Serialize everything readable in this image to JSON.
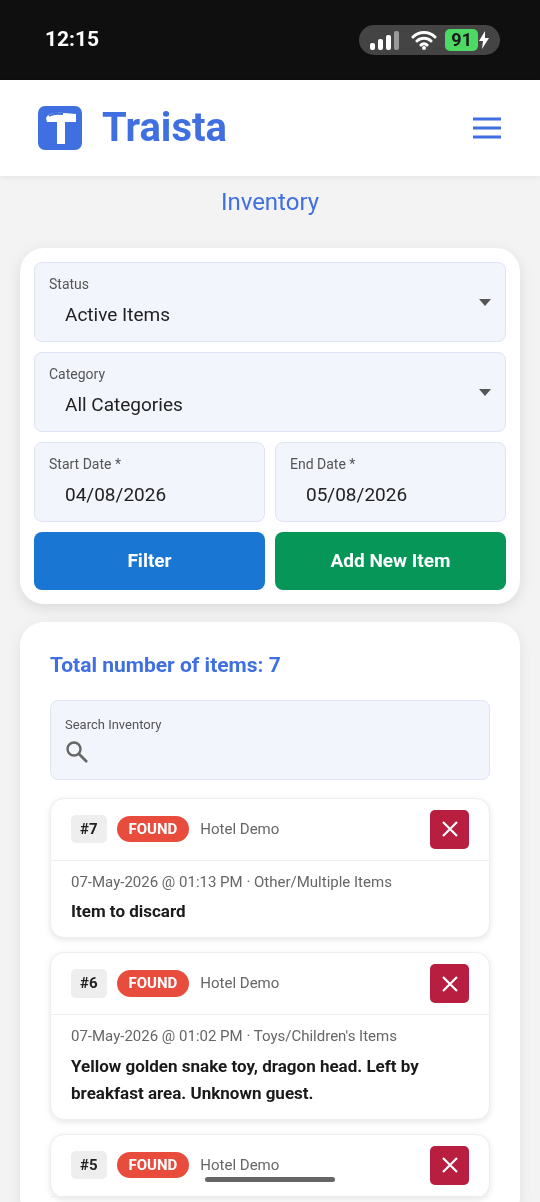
{
  "status_bar": {
    "time": "12:15",
    "battery": "91"
  },
  "header": {
    "brand": "Traista"
  },
  "page_title": "Inventory",
  "filters": {
    "fields": [
      {
        "label": "Status",
        "value": "Active Items",
        "kind": "select"
      },
      {
        "label": "Category",
        "value": "All Categories",
        "kind": "select"
      }
    ],
    "dates": [
      {
        "label": "Start Date *",
        "value": "04/08/2026"
      },
      {
        "label": "End Date *",
        "value": "05/08/2026"
      }
    ],
    "buttons": [
      {
        "label": "Filter",
        "kind": "primary"
      },
      {
        "label": "Add New Item",
        "kind": "add"
      }
    ]
  },
  "list": {
    "total": "Total number of items: 7",
    "search": {
      "label": "Search Inventory"
    },
    "items": [
      {
        "number": "#7",
        "tag": "FOUND",
        "location": "Hotel Demo",
        "meta": "07-May-2026 @ 01:13 PM · Other/Multiple Items",
        "description": "Item to discard"
      },
      {
        "number": "#6",
        "tag": "FOUND",
        "location": "Hotel Demo",
        "meta": "07-May-2026 @ 01:02 PM · Toys/Children's Items",
        "description": "Yellow golden snake toy, dragon head. Left by breakfast area. Unknown guest."
      },
      {
        "number": "#5",
        "tag": "FOUND",
        "location": "Hotel Demo"
      }
    ]
  }
}
